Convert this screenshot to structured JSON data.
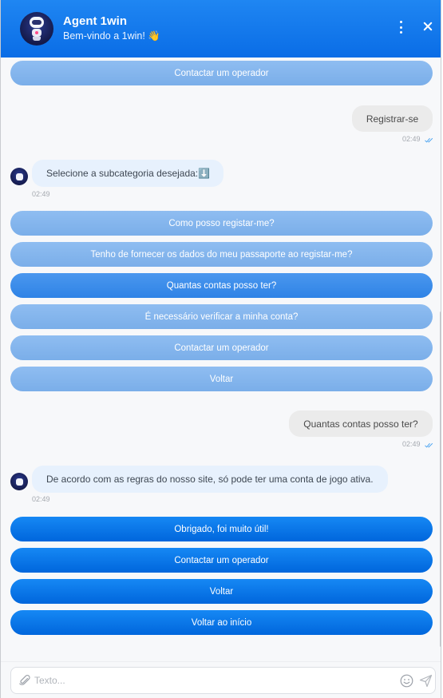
{
  "header": {
    "title": "Agent 1win",
    "subtitle": "Bem-vindo a 1win! 👋"
  },
  "messages": {
    "top_button": "Contactar um operador",
    "user_msg_1": {
      "text": "Registrar-se",
      "time": "02:49"
    },
    "bot_msg_1": {
      "text": "Selecione a subcategoria desejada:⬇️",
      "time": "02:49"
    },
    "options_1": [
      "Como posso registar-me?",
      "Tenho de fornecer os dados do meu passaporte ao registar-me?",
      "Quantas contas posso ter?",
      "É necessário verificar a minha conta?",
      "Contactar um operador",
      "Voltar"
    ],
    "user_msg_2": {
      "text": "Quantas contas posso ter?",
      "time": "02:49"
    },
    "bot_msg_2": {
      "text": "De acordo com as regras do nosso site, só pode ter uma conta de jogo ativa.",
      "time": "02:49"
    },
    "options_2": [
      "Obrigado, foi muito útil!",
      "Contactar um operador",
      "Voltar",
      "Voltar ao início"
    ]
  },
  "footer": {
    "placeholder": "Texto..."
  },
  "colors": {
    "accent": "#0a6de6",
    "button_light": "#7aaee9",
    "button_dark": "#0066dc",
    "ticks": "#4aa3f0"
  },
  "icons": [
    "robot-avatar",
    "kebab-menu-icon",
    "close-icon",
    "double-check-icon",
    "paperclip-icon",
    "emoji-icon",
    "send-icon"
  ]
}
